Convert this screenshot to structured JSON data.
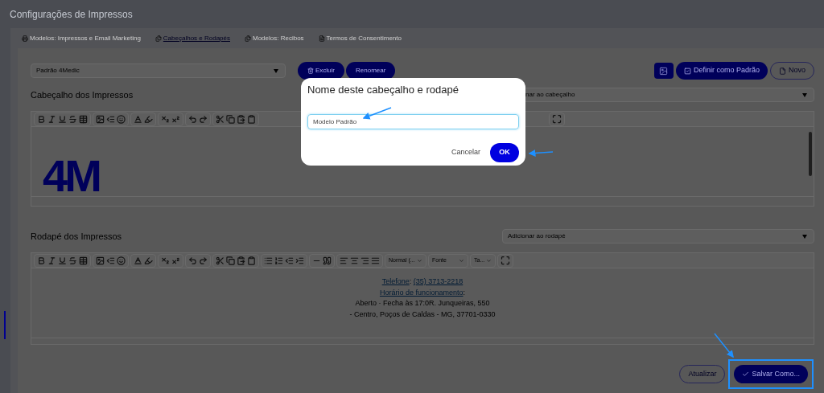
{
  "page": {
    "title": "Configurações de Impressos"
  },
  "tabs": [
    {
      "label": "Modelos: Impressos e Email Marketing",
      "selected": false
    },
    {
      "label": "Cabeçalhos e Rodapés",
      "selected": true
    },
    {
      "label": "Modelos: Recibos",
      "selected": false
    },
    {
      "label": "Termos de Consentimento",
      "selected": false
    }
  ],
  "template_select": {
    "value": "Padrão 4Medic"
  },
  "template_actions": [
    {
      "label": "Excluir"
    },
    {
      "label": "Renomear"
    }
  ],
  "top_actions": [
    {
      "kind": "icon"
    },
    {
      "kind": "filled",
      "label": "Definir como Padrão"
    },
    {
      "kind": "outline",
      "label": "Novo"
    }
  ],
  "header_section": {
    "title": "Cabeçalho dos Impressos",
    "insert_select": "nar ao cabeçalho",
    "logo": "4M"
  },
  "footer_section": {
    "title": "Rodapé dos Impressos",
    "insert_select": "Adicionar ao rodapé",
    "toolbar_dropdowns": [
      "Normal (...",
      "Fonte",
      "Ta..."
    ],
    "lines": [
      [
        {
          "kind": "link",
          "text": "Telefone"
        },
        {
          "kind": "text",
          "text": ": "
        },
        {
          "kind": "link",
          "text": "(35) 3713-2218"
        }
      ],
      [
        {
          "kind": "link",
          "text": "Horário de funcionamento"
        },
        {
          "kind": "text",
          "text": ":"
        }
      ],
      [
        {
          "kind": "text",
          "text": "Aberto · Fecha às 17:0R. Junqueiras, 550"
        }
      ],
      [
        {
          "kind": "text",
          "text": "- Centro, Poços de Caldas - MG, 37701-0330"
        }
      ]
    ]
  },
  "bottom_actions": [
    {
      "kind": "outline",
      "label": "Atualizar",
      "highlighted": false
    },
    {
      "kind": "filled",
      "label": "Salvar Como...",
      "highlighted": true
    }
  ],
  "dialog": {
    "title": "Nome deste cabeçalho e rodapé",
    "value": "Modelo Padrão",
    "buttons": [
      {
        "kind": "text",
        "label": "Cancelar"
      },
      {
        "kind": "primary",
        "label": "OK"
      }
    ]
  }
}
